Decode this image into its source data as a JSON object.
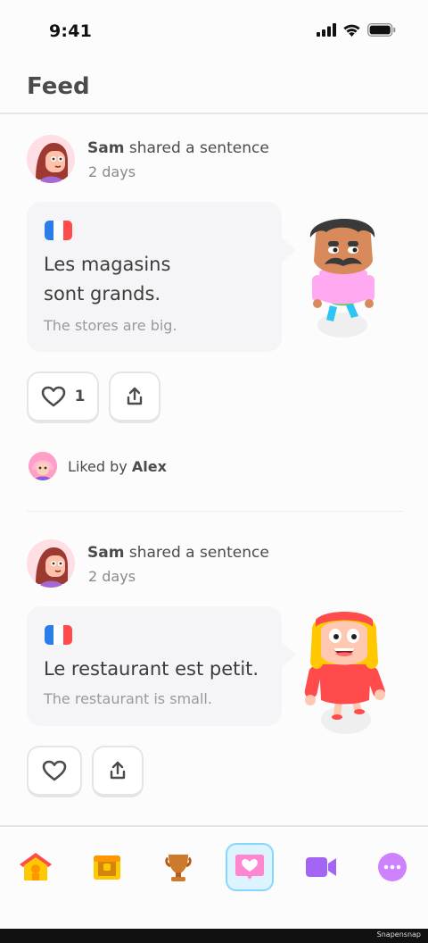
{
  "status": {
    "time": "9:41"
  },
  "header": {
    "title": "Feed"
  },
  "posts": [
    {
      "user": "Sam",
      "action": "shared a sentence",
      "time": "2 days",
      "sentence_lines": [
        "Les magasins",
        "sont grands."
      ],
      "translation": "The stores are big.",
      "likes": "1",
      "liked_by_prefix": "Liked by",
      "liked_by_name": "Alex"
    },
    {
      "user": "Sam",
      "action": "shared a sentence",
      "time": "2 days",
      "sentence_lines": [
        "Le restaurant est petit."
      ],
      "translation": "The restaurant is small."
    }
  ],
  "tabs": [
    {
      "icon": "home-icon"
    },
    {
      "icon": "chest-icon"
    },
    {
      "icon": "trophy-icon"
    },
    {
      "icon": "feed-heart-icon",
      "active": true
    },
    {
      "icon": "video-icon"
    },
    {
      "icon": "more-icon"
    }
  ],
  "colors": {
    "accent": "#84d8ff",
    "like_pink": "#ff86d0",
    "video": "#a465f5"
  },
  "watermark": "Snapensnap"
}
